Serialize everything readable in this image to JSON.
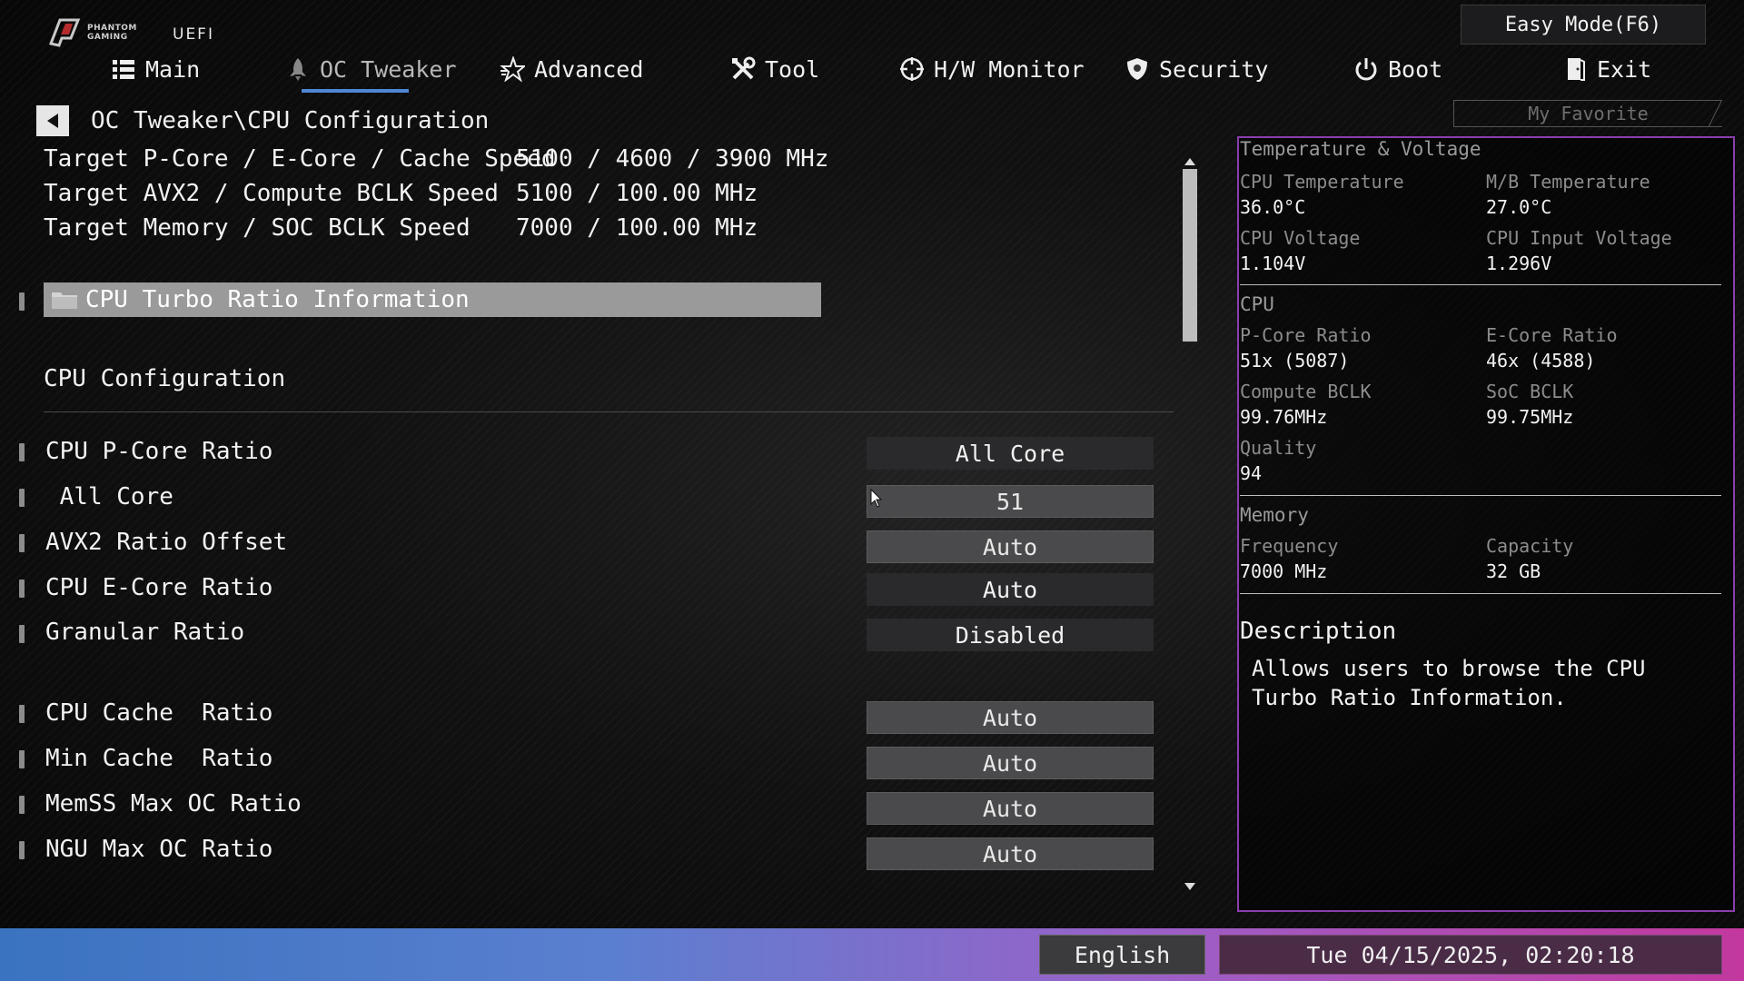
{
  "branding": {
    "brand_line1": "PHANTOM",
    "brand_line2": "GAMING",
    "uefi": "UEFI"
  },
  "header": {
    "easy_mode": "Easy Mode(F6)",
    "my_favorite": "My Favorite"
  },
  "nav": {
    "tabs": [
      {
        "label": "Main",
        "icon": "list-icon"
      },
      {
        "label": "OC Tweaker",
        "icon": "rocket-icon",
        "active": true
      },
      {
        "label": "Advanced",
        "icon": "star-icon"
      },
      {
        "label": "Tool",
        "icon": "tools-icon"
      },
      {
        "label": "H/W Monitor",
        "icon": "crosshair-icon"
      },
      {
        "label": "Security",
        "icon": "shield-icon"
      },
      {
        "label": "Boot",
        "icon": "power-icon"
      },
      {
        "label": "Exit",
        "icon": "exit-door-icon"
      }
    ]
  },
  "breadcrumb": "OC Tweaker\\CPU Configuration",
  "targets": [
    {
      "label": "Target P-Core / E-Core / Cache Speed",
      "value": "5100 / 4600 / 3900 MHz"
    },
    {
      "label": "Target AVX2 / Compute BCLK Speed",
      "value": "5100 / 100.00 MHz"
    },
    {
      "label": "Target Memory / SOC BCLK Speed",
      "value": "7000 / 100.00 MHz"
    }
  ],
  "turbo_ratio_info": "CPU Turbo Ratio Information",
  "section_title": "CPU Configuration",
  "options": [
    {
      "label": "CPU P-Core Ratio",
      "value": "All Core"
    },
    {
      "label": " All Core",
      "value": "51"
    },
    {
      "label": "AVX2 Ratio Offset",
      "value": "Auto"
    },
    {
      "label": "CPU E-Core Ratio",
      "value": "Auto"
    },
    {
      "label": "Granular Ratio",
      "value": "Disabled"
    },
    {
      "label": "CPU Cache  Ratio",
      "value": "Auto"
    },
    {
      "label": "Min Cache  Ratio",
      "value": "Auto"
    },
    {
      "label": "MemSS Max OC Ratio",
      "value": "Auto"
    },
    {
      "label": "NGU Max OC Ratio",
      "value": "Auto"
    }
  ],
  "monitor": {
    "temp_voltage_title": "Temperature & Voltage",
    "cpu_temp_label": "CPU Temperature",
    "cpu_temp": "36.0°C",
    "mb_temp_label": "M/B Temperature",
    "mb_temp": "27.0°C",
    "cpu_voltage_label": "CPU Voltage",
    "cpu_voltage": "1.104V",
    "cpu_input_voltage_label": "CPU Input Voltage",
    "cpu_input_voltage": "1.296V",
    "cpu_title": "CPU",
    "pcore_ratio_label": "P-Core Ratio",
    "pcore_ratio": "51x (5087)",
    "ecore_ratio_label": "E-Core Ratio",
    "ecore_ratio": "46x (4588)",
    "compute_bclk_label": "Compute BCLK",
    "compute_bclk": "99.76MHz",
    "soc_bclk_label": "SoC BCLK",
    "soc_bclk": "99.75MHz",
    "quality_label": "Quality",
    "quality": "94",
    "memory_title": "Memory",
    "frequency_label": "Frequency",
    "frequency": "7000 MHz",
    "capacity_label": "Capacity",
    "capacity": "32 GB"
  },
  "description": {
    "title": "Description",
    "text": "Allows users to browse the CPU Turbo Ratio Information."
  },
  "footer": {
    "language": "English",
    "datetime": "Tue 04/15/2025, 02:20:18"
  },
  "colors": {
    "accent_underline": "#4f86d6",
    "panel_border": "#8a3fae",
    "footer_start": "#3a73c0",
    "footer_end": "#c2389e"
  }
}
